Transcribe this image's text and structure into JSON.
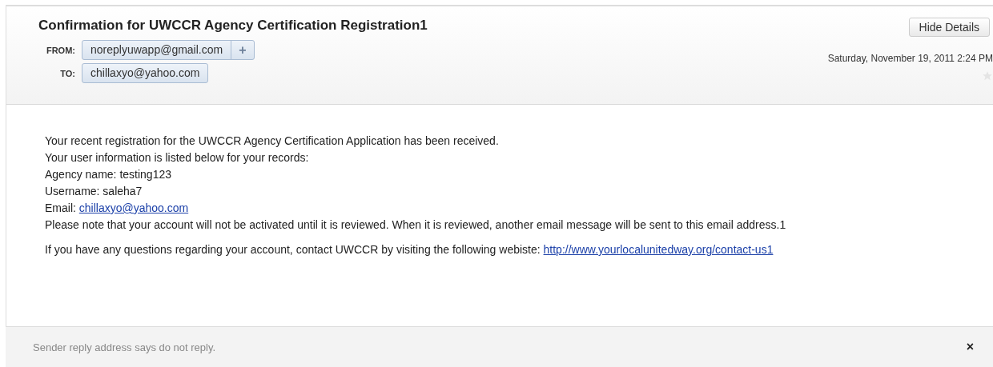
{
  "header": {
    "subject": "Confirmation for UWCCR Agency Certification Registration1",
    "hide_button": "Hide Details",
    "from_label": "FROM:",
    "from": "noreplyuwapp@gmail.com",
    "add_button": "+",
    "to_label": "TO:",
    "to": "chillaxyo@yahoo.com",
    "date": "Saturday, November 19, 2011 2:24 PM",
    "starred": false
  },
  "body": {
    "paragraphs": [
      [
        {
          "text": "Your recent registration for the UWCCR Agency Certification Application has been received."
        },
        {
          "text": "Your user information is listed below for your records:"
        },
        {
          "text": "Agency name: testing123"
        },
        {
          "text": "Username: saleha7"
        },
        {
          "text": "Email: ",
          "link": "chillaxyo@yahoo.com"
        },
        {
          "text": "Please note that your account will not be activated until it is reviewed.  When it is reviewed, another email message will be sent to this email address.1"
        }
      ],
      [
        {
          "text": "If you have any questions regarding your account, contact UWCCR by visiting the following webiste: ",
          "link": "http://www.yourlocalunitedway.org/contact-us1"
        }
      ]
    ]
  },
  "footer": {
    "notice": "Sender reply address says do not reply.",
    "close": "×"
  }
}
